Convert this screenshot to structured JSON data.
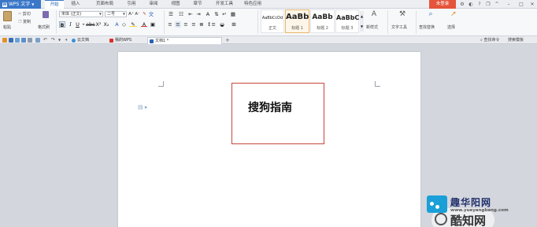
{
  "app": {
    "name": "WPS 文字"
  },
  "menu": {
    "tabs": [
      "开始",
      "插入",
      "页面布局",
      "引用",
      "审阅",
      "视图",
      "章节",
      "开发工具",
      "特色应用"
    ],
    "active_tab": "开始",
    "login": "未登录"
  },
  "ribbon": {
    "paste": "粘贴",
    "cut": "剪切",
    "copy": "复制",
    "format_painter": "格式刷",
    "font_name": "宋体 (正文)",
    "font_size": "二号",
    "styles": [
      {
        "sample": "AaBbCcDd",
        "label": "正文"
      },
      {
        "sample": "AaBb",
        "label": "标题 1"
      },
      {
        "sample": "AaBb",
        "label": "标题 2"
      },
      {
        "sample": "AaBbC",
        "label": "标题 3"
      }
    ],
    "new_style": "新样式",
    "text_tools": "文字工具",
    "find_replace": "查找替换",
    "select": "选择"
  },
  "doc_tabs": {
    "items": [
      {
        "label": "云文档"
      },
      {
        "label": "我的WPS"
      },
      {
        "label": "文档1 *"
      }
    ],
    "add": "+",
    "right_search": "查找命令",
    "right_search2": "搜索模板"
  },
  "document": {
    "title_text": "搜狗指南"
  },
  "watermark": {
    "site_text": "酷知网",
    "brand_text": "趣华阳网",
    "url": "www.yueyangbang.com"
  }
}
